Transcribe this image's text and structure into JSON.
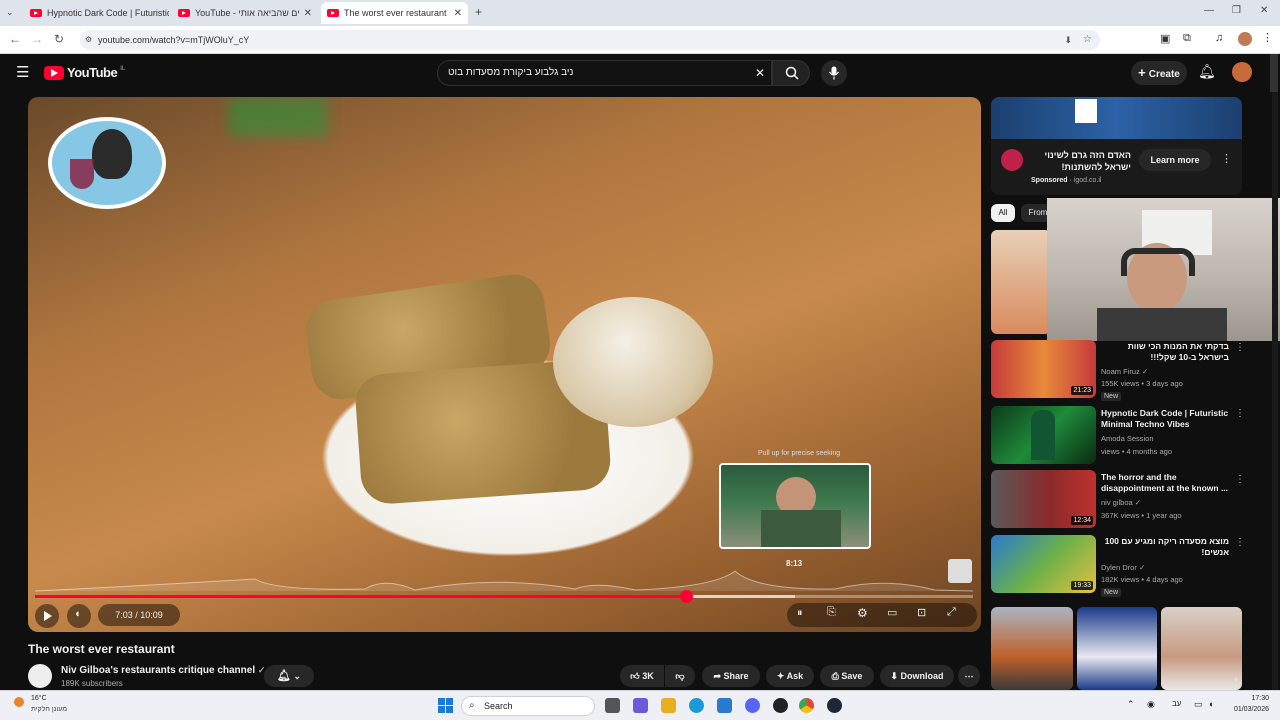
{
  "browser": {
    "tabs": [
      {
        "title": "Hypnotic Dark Code | Futuristic",
        "active": false
      },
      {
        "title": "YouTube - החולרים שהביאה אותי",
        "active": false
      },
      {
        "title": "The worst ever restaurant - YouTube",
        "active": true
      }
    ],
    "url": "youtube.com/watch?v=mTjWOluY_cY"
  },
  "youtube": {
    "logo_text": "YouTube",
    "region": "IL",
    "search_value": "ניב גלבוע ביקורת מסעדות בוט",
    "create_label": "Create"
  },
  "player": {
    "current_time": "7:03",
    "duration": "10:09",
    "time_display": "7:03 / 10:09",
    "progress_fraction": 0.694,
    "hover_fraction": 0.81,
    "hover_time": "8:13",
    "seek_hint": "Pull up for precise seeking"
  },
  "video": {
    "title": "The worst ever restaurant",
    "channel": "Niv Gilboa's restaurants critique channel",
    "subscribers": "189K subscribers",
    "likes": "3K",
    "share_label": "Share",
    "ask_label": "Ask",
    "save_label": "Save",
    "download_label": "Download"
  },
  "ad": {
    "text": "האדם הזה גרם לשינוי ישראל להשתנות!",
    "sponsored": "Sponsored",
    "domain": "igod.co.il",
    "cta": "Learn more"
  },
  "chips": [
    "All",
    "From"
  ],
  "recommendations": [
    {
      "title": "בדקתי את המנות הכי שוות בישראל ב-10 שקל!!!",
      "channel": "Noam Firuz",
      "meta": "155K views • 3 days ago",
      "duration": "21:23",
      "badge": "New"
    },
    {
      "title": "Hypnotic Dark Code | Futuristic Minimal Techno Vibes",
      "channel": "Amoda Session",
      "meta": "views • 4 months ago",
      "duration": "",
      "badge": ""
    },
    {
      "title": "The horror and the disappointment at the known ...",
      "channel": "niv gilboa",
      "meta": "367K views • 1 year ago",
      "duration": "12:34",
      "badge": ""
    },
    {
      "title": "מוצא מסעדה ריקה ומגיע עם 100 אנשים!",
      "channel": "Dylen Dror",
      "meta": "182K views • 4 days ago",
      "duration": "19:33",
      "badge": "New"
    }
  ],
  "taskbar": {
    "weather_temp": "16°C",
    "weather_desc": "מעונן חלקית",
    "search_label": "Search",
    "time": "17:30",
    "date": "01/03/2026"
  },
  "colors": {
    "accent": "#ff0033",
    "bg": "#0f0f0f"
  }
}
